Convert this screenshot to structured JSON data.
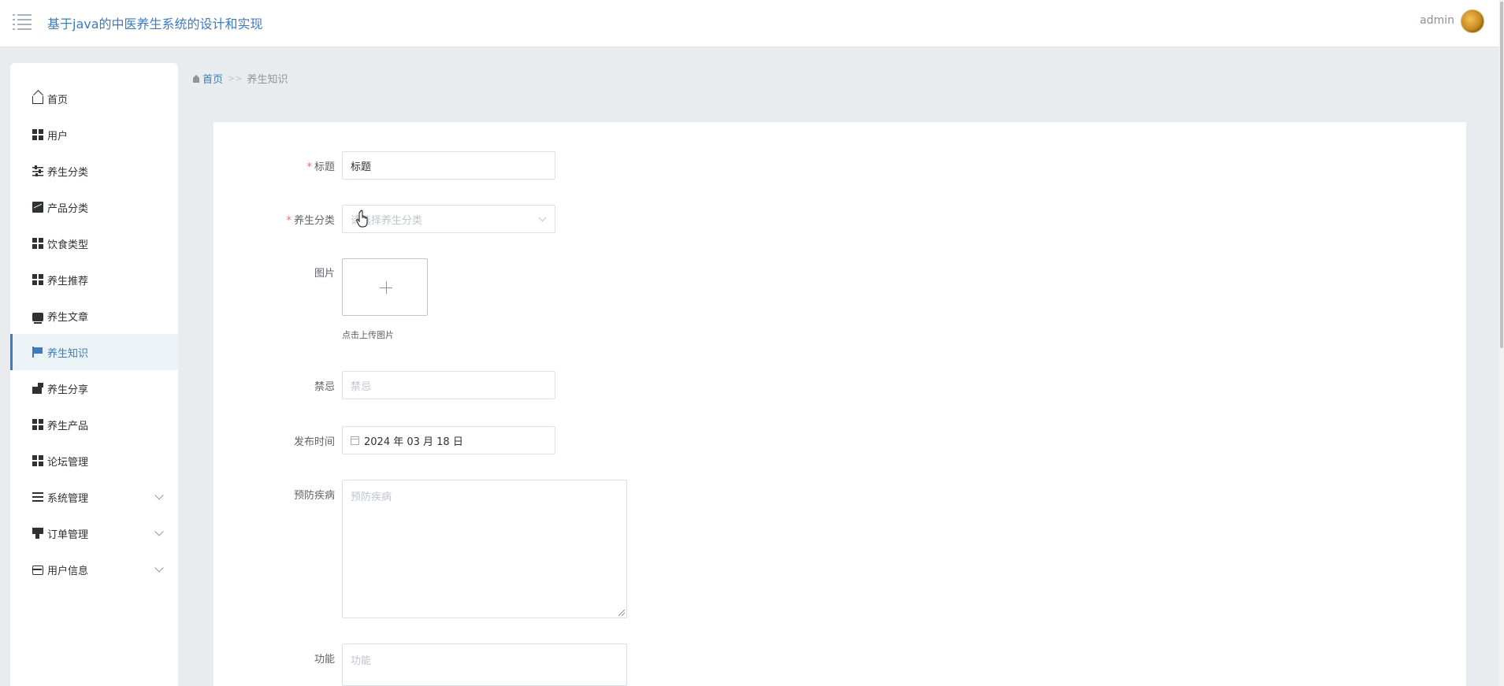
{
  "header": {
    "title": "基于java的中医养生系统的设计和实现",
    "username": "admin"
  },
  "sidebar": {
    "items": [
      {
        "label": "首页",
        "icon": "home-icon"
      },
      {
        "label": "用户",
        "icon": "grid-icon"
      },
      {
        "label": "养生分类",
        "icon": "sliders-icon"
      },
      {
        "label": "产品分类",
        "icon": "chart-icon"
      },
      {
        "label": "饮食类型",
        "icon": "grid-icon"
      },
      {
        "label": "养生推荐",
        "icon": "grid-icon"
      },
      {
        "label": "养生文章",
        "icon": "article-icon"
      },
      {
        "label": "养生知识",
        "icon": "flag-icon",
        "active": true
      },
      {
        "label": "养生分享",
        "icon": "share-icon"
      },
      {
        "label": "养生产品",
        "icon": "grid-icon"
      },
      {
        "label": "论坛管理",
        "icon": "grid-icon"
      },
      {
        "label": "系统管理",
        "icon": "list-icon",
        "expandable": true
      },
      {
        "label": "订单管理",
        "icon": "order-icon",
        "expandable": true
      },
      {
        "label": "用户信息",
        "icon": "card-icon",
        "expandable": true
      }
    ]
  },
  "breadcrumb": {
    "home": "首页",
    "separator": ">>",
    "current": "养生知识"
  },
  "form": {
    "title": {
      "label": "标题",
      "required_mark": "*",
      "value": "标题"
    },
    "category": {
      "label": "养生分类",
      "required_mark": "*",
      "placeholder": "请选择养生分类"
    },
    "image": {
      "label": "图片",
      "hint": "点击上传图片"
    },
    "taboo": {
      "label": "禁忌",
      "placeholder": "禁忌"
    },
    "publish_time": {
      "label": "发布时间",
      "value": "2024 年 03 月 18 日"
    },
    "prevention": {
      "label": "预防疾病",
      "placeholder": "预防疾病"
    },
    "function": {
      "label": "功能",
      "placeholder": "功能"
    }
  },
  "colors": {
    "accent": "#3b7bbf",
    "required": "#f56c6c",
    "page_bg": "#e9ecef"
  }
}
